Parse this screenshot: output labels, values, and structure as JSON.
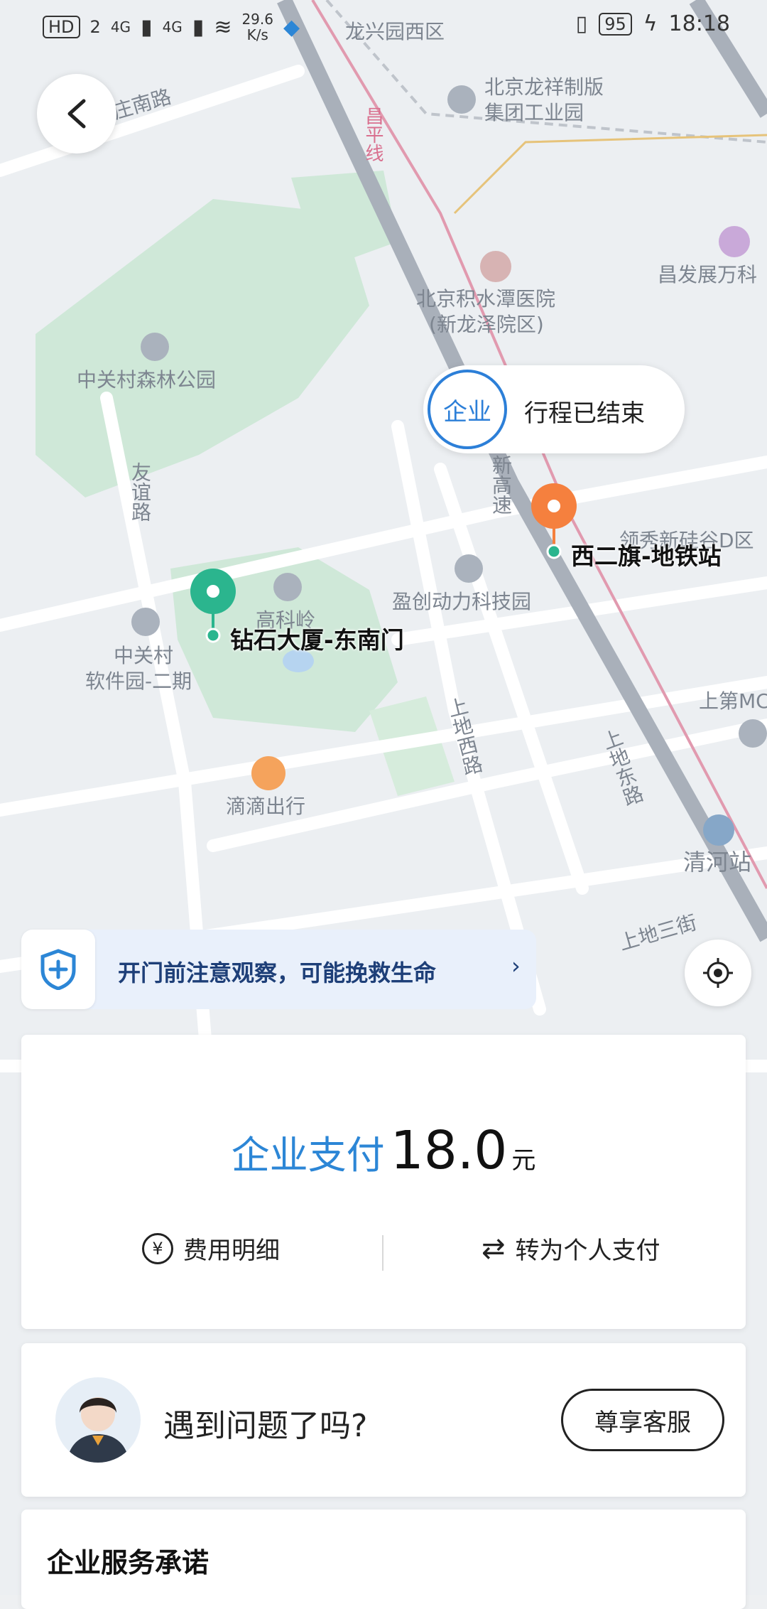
{
  "status_bar": {
    "hd": "HD",
    "sim": "2",
    "net1": "4G",
    "net2": "4G",
    "speed_value": "29.6",
    "speed_unit": "K/s",
    "battery": "95",
    "time": "18:18"
  },
  "map": {
    "labels": {
      "longxingyuan": "龙兴园西区",
      "beijing_print": "北京龙祥制版",
      "beijing_print2": "集团工业园",
      "changping_line": "昌平线",
      "zhuangnan_road": "郑庄南路",
      "changfa": "昌发展万科",
      "hospital1": "北京积水潭医院",
      "hospital2": "(新龙泽院区)",
      "forest_park": "中关村森林公园",
      "youyi_road": "友谊路",
      "xingao": "新高速",
      "lingxiu": "领秀新硅谷D区",
      "yingchuang": "盈创动力科技园",
      "gaoliling": "高科岭",
      "software_park1": "中关村",
      "software_park2": "软件园-二期",
      "didi": "滴滴出行",
      "shangdi_west": "上地西路",
      "shangdi_east": "上地东路",
      "shangdi_mc": "上第MC",
      "qinghe": "清河站",
      "shangdi_3rd": "上地三街"
    }
  },
  "trip_bubble": {
    "badge": "企业",
    "status": "行程已结束"
  },
  "pins": {
    "start_label": "钻石大厦-东南门",
    "end_label": "西二旗-地铁站",
    "start_color": "#2bb58e",
    "end_color": "#f5803e"
  },
  "safety_banner": {
    "text": "开门前注意观察，可能挽救生命",
    "chevron": "›"
  },
  "payment": {
    "method": "企业支付",
    "amount": "18.0",
    "unit": "元",
    "detail_icon": "¥",
    "detail_label": "费用明细",
    "switch_icon": "⇄",
    "switch_label": "转为个人支付"
  },
  "help": {
    "question": "遇到问题了吗?",
    "service_button": "尊享客服"
  },
  "promise": {
    "title": "企业服务承诺"
  },
  "colors": {
    "accent_blue": "#2c86d6",
    "banner_text": "#1e3f78"
  }
}
